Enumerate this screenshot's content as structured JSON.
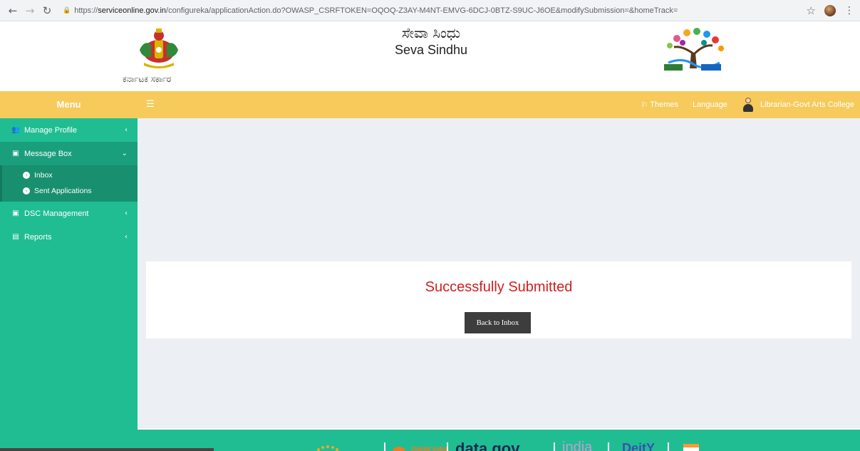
{
  "browser": {
    "url_prefix": "https://",
    "url_host": "serviceonline.gov.in",
    "url_path": "/configureka/applicationAction.do?OWASP_CSRFTOKEN=OQOQ-Z3AY-M4NT-EMVG-6DCJ-0BTZ-S9UC-J6OE&modifySubmission=&homeTrack="
  },
  "header": {
    "state_name": "ಕರ್ನಾಟಕ ಸರ್ಕಾರ",
    "title_kannada": "ಸೇವಾ ಸಿಂಧು",
    "title_english": "Seva Sindhu"
  },
  "topbar": {
    "menu_label": "Menu",
    "themes_label": "Themes",
    "language_label": "Language",
    "user_name": "Librarian-Govt Arts College"
  },
  "sidebar": {
    "items": [
      {
        "label": "Manage Profile",
        "icon": "users-icon"
      },
      {
        "label": "Message Box",
        "icon": "message-box-icon"
      },
      {
        "label": "DSC Management",
        "icon": "dsc-icon"
      },
      {
        "label": "Reports",
        "icon": "file-icon"
      }
    ],
    "message_box_sub": [
      {
        "label": "Inbox"
      },
      {
        "label": "Sent Applications"
      }
    ]
  },
  "main": {
    "success_message": "Successfully Submitted",
    "back_button_label": "Back to Inbox"
  },
  "footer": {
    "logos": [
      "Digital India",
      "data.gov",
      "india",
      "DeitY"
    ]
  },
  "colors": {
    "sidebar": "#20bd93",
    "topbar": "#f7ca5c",
    "success_text": "#d01f1f",
    "button": "#3d3d3d"
  }
}
